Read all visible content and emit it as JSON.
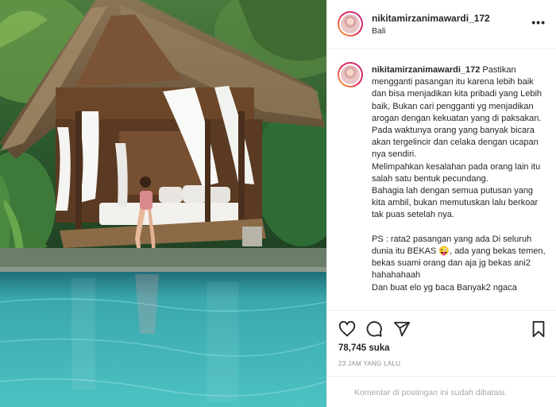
{
  "post": {
    "username": "nikitamirzanimawardi_172",
    "location": "Bali",
    "more_icon": "more-horizontal-icon",
    "caption": {
      "username": "nikitamirzanimawardi_172",
      "text": " Pastikan mengganti pasangan itu karena lebih baik dan bisa menjadikan kita pribadi yang Lebih baik, Bukan cari pengganti yg menjadikan arogan dengan kekuatan yang di paksakan.\nPada waktunya orang yang banyak bicara akan tergelincir dan celaka dengan ucapan nya sendiri.\nMelimpahkan kesalahan pada orang lain itu salah satu bentuk pecundang.\nBahagia lah dengan semua putusan yang kita ambil, bukan memutuskan lalu berkoar tak puas setelah nya.\n\nPS : rata2 pasangan yang ada Di seluruh dunia itu BEKAS 😜, ada yang bekas temen, bekas suami orang dan aja jg bekas ani2 hahahahaah\nDan buat elo yg baca Banyak2 ngaca"
    },
    "actions": {
      "like_icon": "heart-icon",
      "comment_icon": "comment-icon",
      "share_icon": "share-icon",
      "save_icon": "bookmark-icon"
    },
    "likes": "78,745 suka",
    "time_ago": "23 JAM YANG LALU",
    "comments_disabled": "Komentar di postingan ini sudah dibatasi."
  },
  "colors": {
    "text": "#262626",
    "secondary": "#8e8e8e",
    "border": "#efefef",
    "pool": "#3fb6b9"
  }
}
